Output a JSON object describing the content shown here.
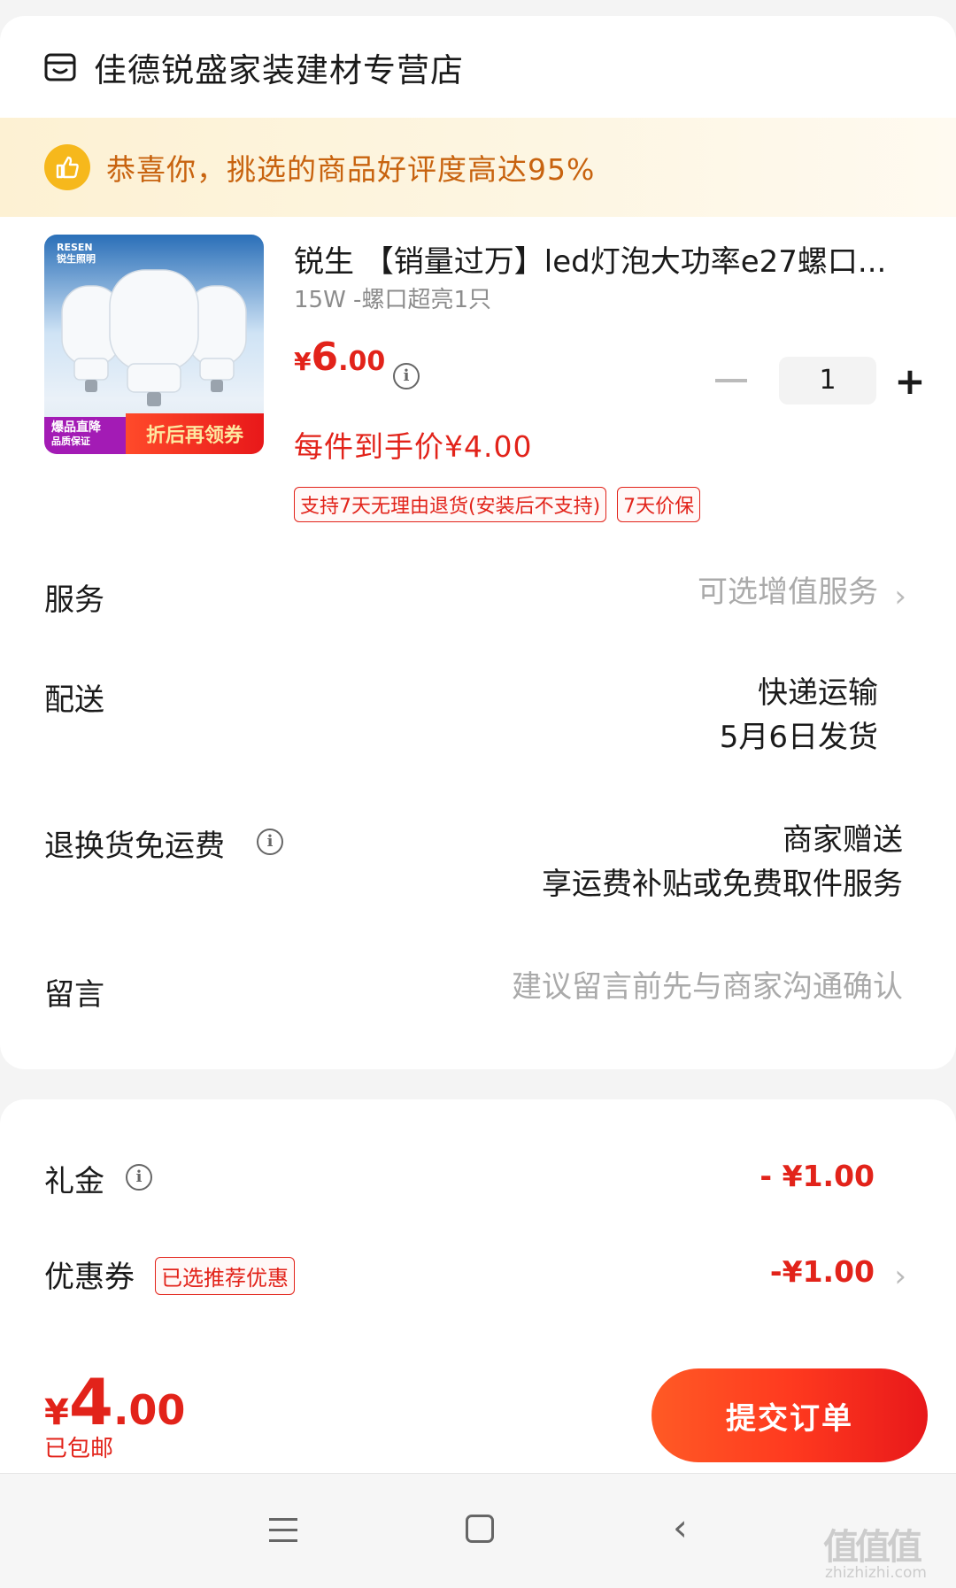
{
  "shop": {
    "name": "佳德锐盛家装建材专营店",
    "icon": "store-icon"
  },
  "banner": {
    "text": "恭喜你，挑选的商品好评度高达95%",
    "icon": "thumbs-up-icon",
    "accent": "#c8630f"
  },
  "product": {
    "image": {
      "brand_line1": "RESEN",
      "brand_line2": "锐生照明",
      "badge_left_line1": "爆品直降",
      "badge_left_line2": "品质保证",
      "badge_right": "折后再领券"
    },
    "title": "锐生 【销量过万】led灯泡大功率e27螺口...",
    "spec": "15W -螺口超亮1只",
    "price": {
      "currency": "¥",
      "integer": "6",
      "decimal": ".00"
    },
    "quantity": "1",
    "minus_label": "−",
    "plus_label": "+",
    "final_price": "每件到手价¥4.00",
    "tags": [
      "支持7天无理由退货(安装后不支持)",
      "7天价保"
    ]
  },
  "rows": {
    "service": {
      "label": "服务",
      "value": "可选增值服务"
    },
    "delivery": {
      "label": "配送",
      "line1": "快递运输",
      "line2": "5月6日发货"
    },
    "return_fee": {
      "label": "退换货免运费",
      "line1": "商家赠送",
      "line2": "享运费补贴或免费取件服务"
    },
    "message": {
      "label": "留言",
      "placeholder": "建议留言前先与商家沟通确认"
    }
  },
  "discounts": {
    "gift": {
      "label": "礼金",
      "value": "- ¥1.00"
    },
    "coupon": {
      "label": "优惠券",
      "tag": "已选推荐优惠",
      "value": "-¥1.00"
    }
  },
  "footer": {
    "total": {
      "currency": "¥",
      "integer": "4",
      "decimal": ".00"
    },
    "shipping_note": "已包邮",
    "submit_label": "提交订单"
  },
  "watermark": {
    "text": "值值值",
    "sub": "zhizhizhi.com"
  },
  "colors": {
    "accent_red": "#e2231a",
    "button_orange": "#ff3a1f",
    "banner_bg": "#fdf1d3"
  }
}
